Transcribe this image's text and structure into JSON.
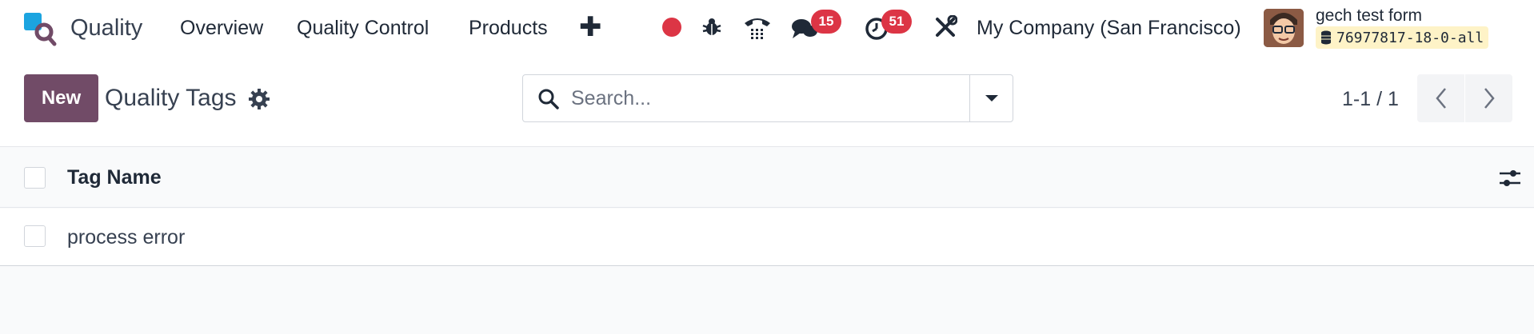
{
  "navbar": {
    "app_name": "Quality",
    "menu": [
      "Overview",
      "Quality Control",
      "Products"
    ],
    "plus_label": "✚",
    "messages_count": "15",
    "activities_count": "51",
    "company": "My Company (San Francisco)",
    "user_name": "gech test form",
    "database": "76977817-18-0-all"
  },
  "control": {
    "new_label": "New",
    "title": "Quality Tags",
    "search_placeholder": "Search...",
    "pager": "1-1 / 1"
  },
  "list": {
    "columns": [
      "Tag Name"
    ],
    "rows": [
      {
        "name": "process error"
      }
    ]
  },
  "colors": {
    "primary": "#714b67",
    "badge": "#dc3545",
    "db_badge_bg": "#fef3c7"
  },
  "icons": {
    "app_logo": "quality-logo-icon",
    "record": "record-icon",
    "debug": "bug-icon",
    "phone": "phone-icon",
    "messages": "chat-icon",
    "activities": "clock-icon",
    "settings": "tools-icon",
    "database": "database-icon",
    "gear": "gear-icon",
    "search": "search-icon",
    "dropdown": "caret-down-icon",
    "prev": "chevron-left-icon",
    "next": "chevron-right-icon",
    "optional_columns": "sliders-icon"
  }
}
